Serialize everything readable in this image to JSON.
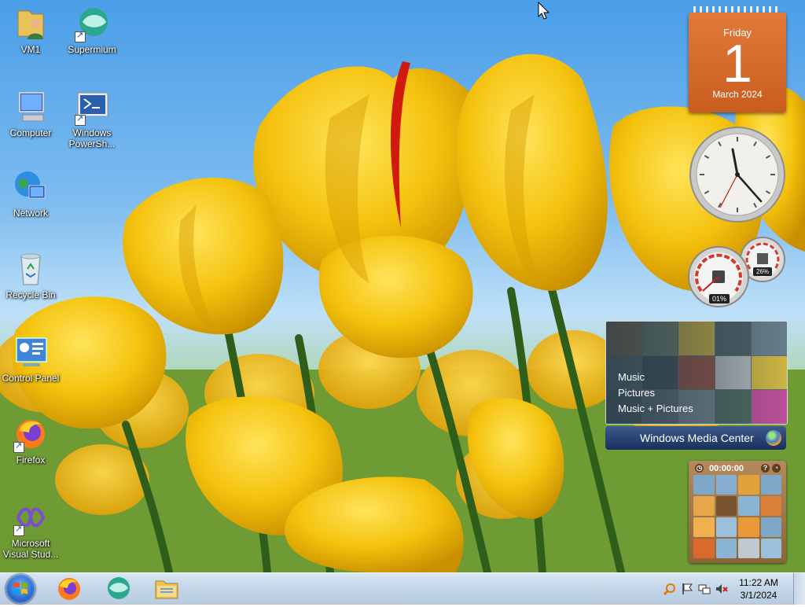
{
  "desktop_icons": [
    {
      "label": "VM1",
      "icon": "user-folder-icon"
    },
    {
      "label": "Supermium",
      "icon": "supermium-icon"
    },
    {
      "label": "Computer",
      "icon": "computer-icon"
    },
    {
      "label": "Windows PowerSh...",
      "icon": "powershell-icon"
    },
    {
      "label": "Network",
      "icon": "network-icon"
    },
    {
      "label": "Recycle Bin",
      "icon": "recycle-bin-icon"
    },
    {
      "label": "Control Panel",
      "icon": "control-panel-icon"
    },
    {
      "label": "Firefox",
      "icon": "firefox-icon"
    },
    {
      "label": "Microsoft Visual Stud...",
      "icon": "visual-studio-icon"
    }
  ],
  "calendar": {
    "weekday": "Friday",
    "day": "1",
    "month_year": "March 2024"
  },
  "meters": {
    "cpu": "01%",
    "memory": "26%"
  },
  "media_center": {
    "menu": [
      "Music",
      "Pictures",
      "Music + Pictures"
    ],
    "title": "Windows Media Center"
  },
  "puzzle": {
    "timer": "00:00:00"
  },
  "taskbar": {
    "pinned": [
      "start-button",
      "firefox",
      "supermium",
      "file-explorer"
    ],
    "time": "11:22 AM",
    "date": "3/1/2024"
  }
}
